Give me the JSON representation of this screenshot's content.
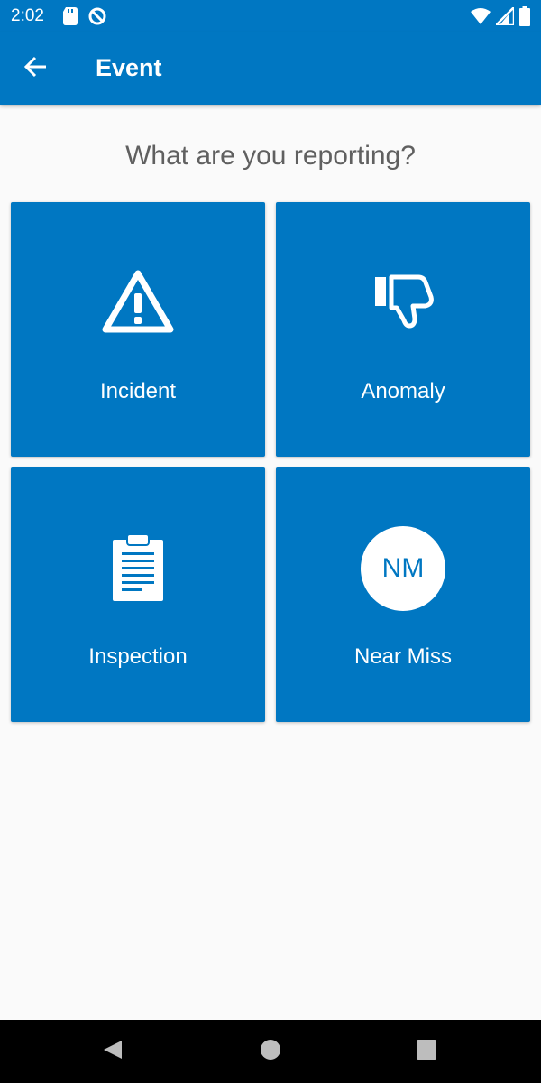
{
  "status_bar": {
    "time": "2:02",
    "icons": [
      "sd-card-icon",
      "data-saver-icon",
      "wifi-icon",
      "signal-icon",
      "battery-icon"
    ]
  },
  "app_bar": {
    "title": "Event",
    "back_icon": "arrow-back-icon",
    "background": "#0077c2"
  },
  "prompt": "What are you reporting?",
  "tiles": [
    {
      "label": "Incident",
      "icon": "warning-icon"
    },
    {
      "label": "Anomaly",
      "icon": "thumbs-down-icon"
    },
    {
      "label": "Inspection",
      "icon": "clipboard-icon"
    },
    {
      "label": "Near Miss",
      "icon": "near-miss-icon",
      "icon_text": "NM"
    }
  ],
  "nav_bar": {
    "icons": [
      "back-triangle-icon",
      "home-circle-icon",
      "recents-square-icon"
    ]
  },
  "colors": {
    "accent": "#0077c2",
    "background": "#fafafa",
    "prompt_text": "#606060"
  }
}
